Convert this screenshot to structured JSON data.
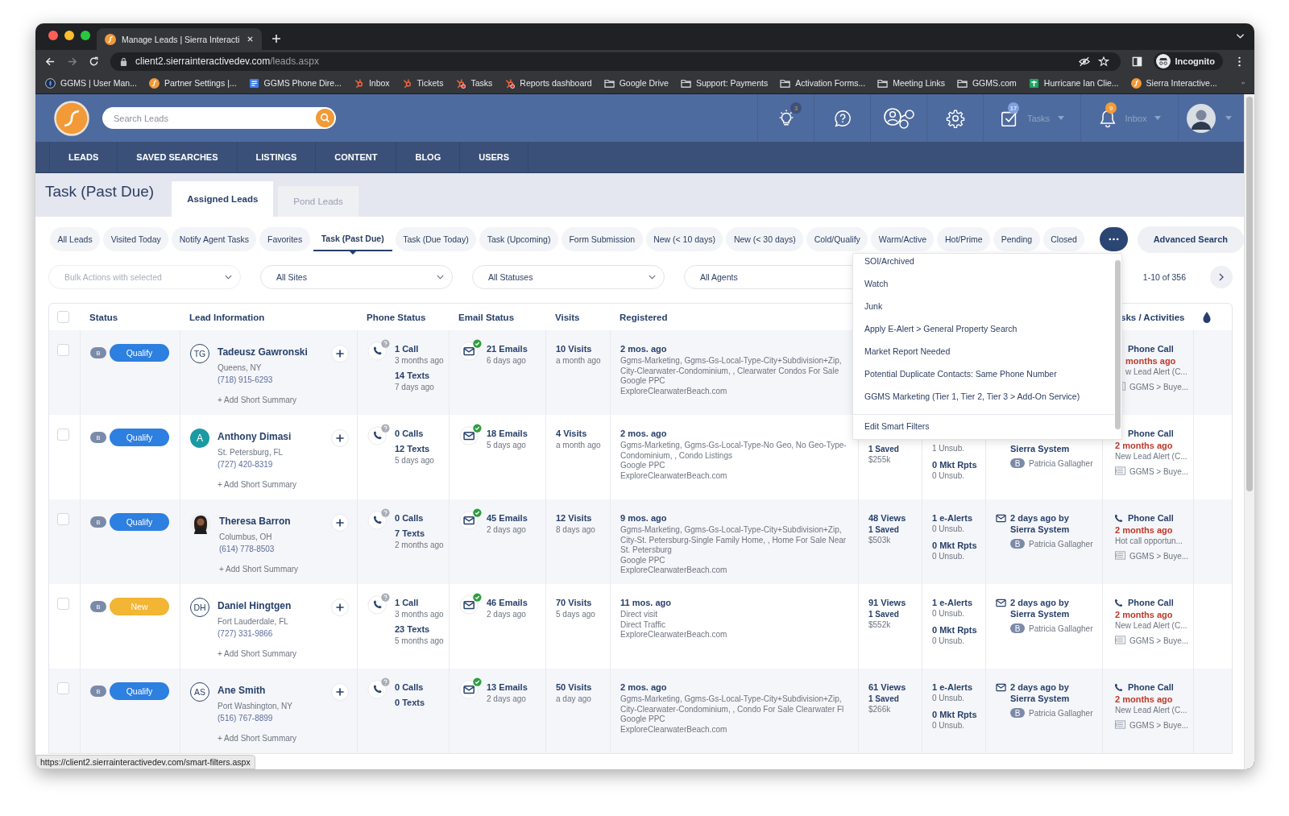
{
  "browser": {
    "tab_title": "Manage Leads | Sierra Interacti",
    "url_host": "client2.sierrainteractivedev.com",
    "url_path": "/leads.aspx",
    "profile": "Incognito",
    "bookmarks": [
      {
        "label": "GGMS | User Man...",
        "kind": "globe"
      },
      {
        "label": "Partner Settings |...",
        "kind": "sierra"
      },
      {
        "label": "GGMS Phone Dire...",
        "kind": "doc"
      },
      {
        "label": "Inbox",
        "kind": "hubspot"
      },
      {
        "label": "Tickets",
        "kind": "hubspot"
      },
      {
        "label": "Tasks",
        "kind": "hubspot-alert"
      },
      {
        "label": "Reports dashboard",
        "kind": "hubspot-alert"
      },
      {
        "label": "Google Drive",
        "kind": "folder"
      },
      {
        "label": "Support: Payments",
        "kind": "folder"
      },
      {
        "label": "Activation Forms...",
        "kind": "folder"
      },
      {
        "label": "Meeting Links",
        "kind": "folder"
      },
      {
        "label": "GGMS.com",
        "kind": "folder"
      },
      {
        "label": "Hurricane Ian Clie...",
        "kind": "sheet"
      },
      {
        "label": "Sierra Interactive...",
        "kind": "sierra"
      }
    ],
    "status_url": "https://client2.sierrainteractivedev.com/smart-filters.aspx"
  },
  "app": {
    "search": {
      "placeholder": "Search Leads"
    },
    "tools": [
      {
        "kind": "bulb",
        "badge": "3"
      },
      {
        "kind": "help"
      },
      {
        "kind": "network"
      },
      {
        "kind": "settings"
      },
      {
        "kind": "tasks",
        "label": "Tasks",
        "badge": "17"
      },
      {
        "kind": "bell",
        "label": "Inbox",
        "badge": "9"
      },
      {
        "kind": "avatar"
      }
    ],
    "nav": [
      "LEADS",
      "SAVED SEARCHES",
      "LISTINGS",
      "CONTENT",
      "BLOG",
      "USERS"
    ]
  },
  "page_title": "Task (Past Due)",
  "view_tabs": [
    {
      "label": "Assigned Leads",
      "selected": true
    },
    {
      "label": "Pond Leads",
      "selected": false
    }
  ],
  "filters": [
    {
      "label": "All Leads",
      "selected": false
    },
    {
      "label": "Visited Today",
      "selected": false
    },
    {
      "label": "Notify Agent Tasks",
      "selected": false
    },
    {
      "label": "Favorites",
      "selected": false
    },
    {
      "label": "Task (Past Due)",
      "selected": true
    },
    {
      "label": "Task (Due Today)",
      "selected": false
    },
    {
      "label": "Task (Upcoming)",
      "selected": false
    },
    {
      "label": "Form Submission",
      "selected": false
    },
    {
      "label": "New (< 10 days)",
      "selected": false
    },
    {
      "label": "New (< 30 days)",
      "selected": false
    },
    {
      "label": "Cold/Qualify",
      "selected": false
    },
    {
      "label": "Warm/Active",
      "selected": false
    },
    {
      "label": "Hot/Prime",
      "selected": false
    },
    {
      "label": "Pending",
      "selected": false
    },
    {
      "label": "Closed",
      "selected": false
    }
  ],
  "more_filters": {
    "expanded": true,
    "items": [
      "SOI/Archived",
      "Watch",
      "Junk",
      "Apply E-Alert > General Property Search",
      "Market Report Needed",
      "Potential Duplicate Contacts: Same Phone Number",
      "GGMS Marketing (Tier 1, Tier 2, Tier 3 > Add-On Service)"
    ],
    "footer": "Edit Smart Filters"
  },
  "advanced_search": "Advanced Search",
  "selects": [
    {
      "value": "Bulk Actions with selected",
      "disabled": true
    },
    {
      "value": "All Sites",
      "disabled": false
    },
    {
      "value": "All Statuses",
      "disabled": false
    },
    {
      "value": "All Agents",
      "disabled": false
    }
  ],
  "pagination": "1-10 of 356",
  "table": {
    "select_all": {
      "checked": false
    },
    "columns": [
      "Status",
      "Lead Information",
      "Phone Status",
      "Email Status",
      "Visits",
      "Registered",
      "sks / Activities"
    ],
    "rows": [
      {
        "checked": false,
        "grade": "B",
        "status": "Qualify",
        "color": "#2d7fe0",
        "avatar": {
          "kind": "initials",
          "initials": "TG"
        },
        "name": "Tadeusz Gawronski",
        "location": "Queens, NY",
        "phone": "(718) 915-6293",
        "summary": "+ Add Short Summary",
        "phone_status": [
          {
            "count": "1 Call",
            "when": "3 months ago"
          },
          {
            "count": "14 Texts",
            "when": "7 days ago"
          }
        ],
        "email": {
          "count": "21 Emails",
          "when": "6 days ago"
        },
        "visits": {
          "count": "10 Visits",
          "when": "a month ago"
        },
        "registered": {
          "when": "2 mos. ago",
          "lines": [
            "Ggms-Marketing, Ggms-Gs-Local-Type-City+Subdivision+Zip, City-Clearwater-Condominium, , Clearwater Condos For Sale",
            "Google PPC",
            "ExploreClearwaterBeach.com"
          ]
        },
        "task": {
          "phone_icon": false,
          "cut": true,
          "title": "Phone Call",
          "when": "months ago",
          "note": "w Lead Alert (C...",
          "plan": "GGMS > Buye..."
        }
      },
      {
        "checked": false,
        "grade": "B",
        "status": "Qualify",
        "color": "#2d7fe0",
        "avatar": {
          "kind": "filled",
          "initials": "A",
          "color": "#1b9aa3"
        },
        "name": "Anthony Dimasi",
        "location": "St. Petersburg, FL",
        "phone": "(727) 420-8319",
        "summary": "+ Add Short Summary",
        "phone_status": [
          {
            "count": "0 Calls"
          },
          {
            "count": "12 Texts",
            "when": "5 days ago"
          }
        ],
        "email": {
          "count": "18 Emails",
          "when": "5 days ago"
        },
        "visits": {
          "count": "4 Visits",
          "when": "a month ago"
        },
        "registered": {
          "when": "2 mos. ago",
          "lines": [
            "Ggms-Marketing, Ggms-Gs-Local-Type-No Geo, No Geo-Type-Condominium, , Condo Listings",
            "Google PPC",
            "ExploreClearwaterBeach.com"
          ]
        },
        "views": {
          "saved": "1 Saved",
          "price": "$255k"
        },
        "alerts": {
          "unsub": "1 Unsub.",
          "reports": "0 Mkt Rpts",
          "reports_unsub": "0 Unsub."
        },
        "activity": {
          "by": "Sierra System",
          "agent_grade": "B",
          "agent": "Patricia Gallagher"
        },
        "task": {
          "phone_icon": false,
          "cut": false,
          "title": "Phone Call",
          "when": "2 months ago",
          "note": "New Lead Alert (C...",
          "plan": "GGMS > Buye..."
        }
      },
      {
        "checked": false,
        "grade": "B",
        "status": "Qualify",
        "color": "#2d7fe0",
        "avatar": {
          "kind": "photo"
        },
        "name": "Theresa Barron",
        "location": "Columbus, OH",
        "phone": "(614) 778-8503",
        "summary": "+ Add Short Summary",
        "phone_status": [
          {
            "count": "0 Calls"
          },
          {
            "count": "7 Texts",
            "when": "2 months ago"
          }
        ],
        "email": {
          "count": "45 Emails",
          "when": "2 days ago"
        },
        "visits": {
          "count": "12 Visits",
          "when": "8 days ago"
        },
        "registered": {
          "when": "9 mos. ago",
          "lines": [
            "Ggms-Marketing, Ggms-Gs-Local-Type-City+Subdivision+Zip, City-St. Petersburg-Single Family Home, , Home For Sale Near St. Petersburg",
            "Google PPC",
            "ExploreClearwaterBeach.com"
          ]
        },
        "views": {
          "count": "48 Views",
          "saved": "1 Saved",
          "price": "$503k"
        },
        "alerts": {
          "count": "1 e-Alerts",
          "unsub": "0 Unsub.",
          "reports": "0 Mkt Rpts",
          "reports_unsub": "0 Unsub."
        },
        "activity": {
          "when": "2 days ago by",
          "by": "Sierra System",
          "agent_grade": "B",
          "agent": "Patricia Gallagher"
        },
        "task": {
          "phone_icon": true,
          "cut": false,
          "title": "Phone Call",
          "when": "2 months ago",
          "note": "Hot call opportun...",
          "plan": "GGMS > Buye..."
        }
      },
      {
        "checked": false,
        "grade": "B",
        "status": "New",
        "color": "#f2b534",
        "avatar": {
          "kind": "initials",
          "initials": "DH"
        },
        "name": "Daniel Hingtgen",
        "location": "Fort Lauderdale, FL",
        "phone": "(727) 331-9866",
        "summary": "+ Add Short Summary",
        "phone_status": [
          {
            "count": "1 Call",
            "when": "3 months ago"
          },
          {
            "count": "23 Texts",
            "when": "5 months ago"
          }
        ],
        "email": {
          "count": "46 Emails",
          "when": "2 days ago"
        },
        "visits": {
          "count": "70 Visits",
          "when": "5 days ago"
        },
        "registered": {
          "when": "11 mos. ago",
          "lines": [
            "Direct visit",
            "Direct Traffic",
            "ExploreClearwaterBeach.com"
          ]
        },
        "views": {
          "count": "91 Views",
          "saved": "1 Saved",
          "price": "$552k"
        },
        "alerts": {
          "count": "1 e-Alerts",
          "unsub": "0 Unsub.",
          "reports": "0 Mkt Rpts",
          "reports_unsub": "0 Unsub."
        },
        "activity": {
          "when": "2 days ago by",
          "by": "Sierra System",
          "agent_grade": "B",
          "agent": "Patricia Gallagher"
        },
        "task": {
          "phone_icon": true,
          "cut": false,
          "title": "Phone Call",
          "when": "2 months ago",
          "note": "New Lead Alert (C...",
          "plan": "GGMS > Buye..."
        }
      },
      {
        "checked": false,
        "grade": "B",
        "status": "Qualify",
        "color": "#2d7fe0",
        "avatar": {
          "kind": "initials",
          "initials": "AS"
        },
        "name": "Ane Smith",
        "location": "Port Washington, NY",
        "phone": "(516) 767-8899",
        "summary": "+ Add Short Summary",
        "phone_status": [
          {
            "count": "0 Calls"
          },
          {
            "count": "0 Texts"
          }
        ],
        "email": {
          "count": "13 Emails",
          "when": "2 days ago"
        },
        "visits": {
          "count": "50 Visits",
          "when": "a day ago"
        },
        "registered": {
          "when": "2 mos. ago",
          "lines": [
            "Ggms-Marketing, Ggms-Gs-Local-Type-City+Subdivision+Zip, City-Clearwater-Condominium, , Condo For Sale Clearwater Fl",
            "Google PPC",
            "ExploreClearwaterBeach.com"
          ]
        },
        "views": {
          "count": "61 Views",
          "saved": "1 Saved",
          "price": "$266k"
        },
        "alerts": {
          "count": "1 e-Alerts",
          "unsub": "0 Unsub.",
          "reports": "0 Mkt Rpts",
          "reports_unsub": "0 Unsub."
        },
        "activity": {
          "when": "2 days ago by",
          "by": "Sierra System",
          "agent_grade": "B",
          "agent": "Patricia Gallagher"
        },
        "task": {
          "phone_icon": true,
          "cut": false,
          "title": "Phone Call",
          "when": "2 months ago",
          "note": "New Lead Alert (C...",
          "plan": "GGMS > Buye..."
        }
      }
    ]
  }
}
